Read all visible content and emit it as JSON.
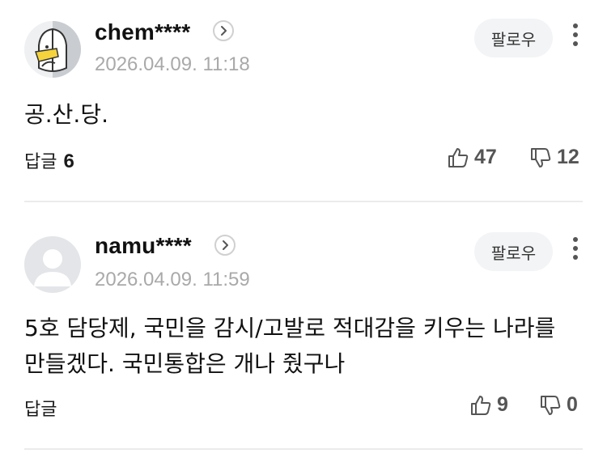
{
  "comments": [
    {
      "username": "chem****",
      "date": "2026.04.09. 11:18",
      "follow_label": "팔로우",
      "text": "공.산.당.",
      "reply_label": "답글",
      "reply_count": "6",
      "likes": "47",
      "dislikes": "12",
      "avatar_icon": "masked-face-avatar-icon"
    },
    {
      "username": "namu****",
      "date": "2026.04.09. 11:59",
      "follow_label": "팔로우",
      "text": "5호 담당제, 국민을 감시/고발로 적대감을 키우는 나라를 만들겠다. 국민통합은 개나 줬구나",
      "reply_label": "답글",
      "reply_count": "",
      "likes": "9",
      "dislikes": "0",
      "avatar_icon": "default-user-avatar-icon"
    }
  ],
  "colors": {
    "follow_bg": "#f3f4f6",
    "date_text": "#a9a9a9",
    "divider": "#ebebeb"
  }
}
